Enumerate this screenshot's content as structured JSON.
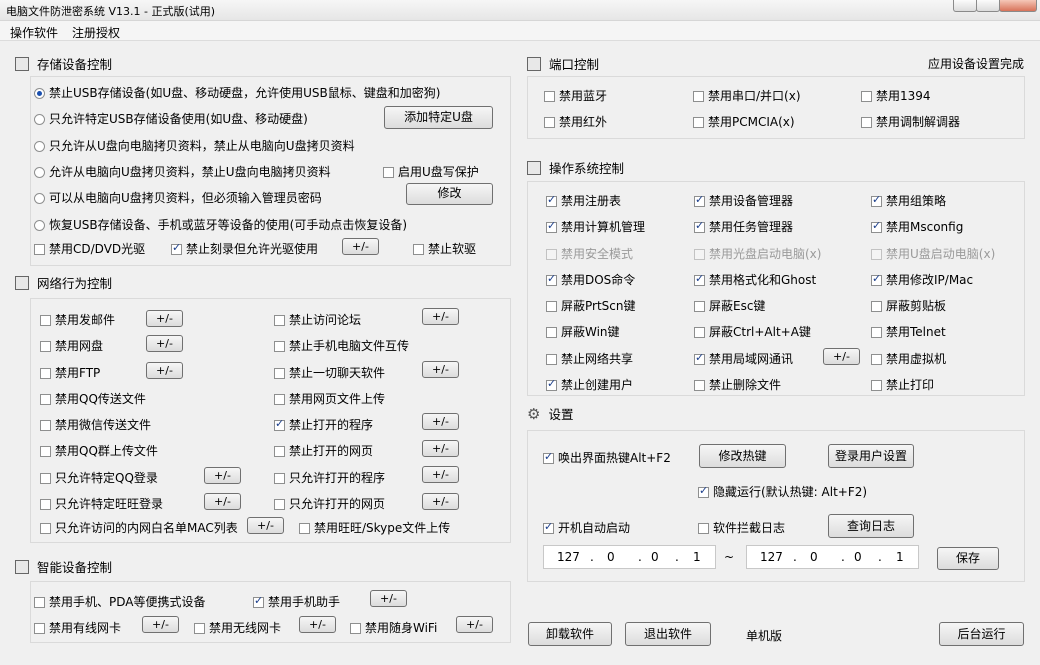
{
  "window": {
    "title": "电脑文件防泄密系统 V13.1 - 正式版(试用)"
  },
  "menu": [
    "操作软件",
    "注册授权"
  ],
  "storage": {
    "title": "存储设备控制",
    "radios": [
      {
        "label": "禁止USB存储设备(如U盘、移动硬盘，允许使用USB鼠标、键盘和加密狗)",
        "checked": true
      },
      {
        "label": "只允许特定USB存储设备使用(如U盘、移动硬盘)",
        "checked": false
      },
      {
        "label": "只允许从U盘向电脑拷贝资料，禁止从电脑向U盘拷贝资料",
        "checked": false
      },
      {
        "label": "允许从电脑向U盘拷贝资料，禁止U盘向电脑拷贝资料",
        "checked": false
      },
      {
        "label": "可以从电脑向U盘拷贝资料，但必须输入管理员密码",
        "checked": false
      },
      {
        "label": "恢复USB存储设备、手机或蓝牙等设备的使用(可手动点击恢复设备)",
        "checked": false
      }
    ],
    "add_usb_button": "添加特定U盘",
    "write_protect": {
      "label": "启用U盘写保护",
      "checked": false
    },
    "modify_button": "修改",
    "cd_disable": {
      "label": "禁用CD/DVD光驱",
      "checked": false
    },
    "burn_disable": {
      "label": "禁止刻录但允许光驱使用",
      "checked": true
    },
    "pm_button": "+/-",
    "floppy_disable": {
      "label": "禁止软驱",
      "checked": false
    }
  },
  "network": {
    "title": "网络行为控制",
    "items": [
      {
        "label": "禁用发邮件",
        "checked": false,
        "pm": true
      },
      {
        "label": "禁止访问论坛",
        "checked": false,
        "pm": true
      },
      {
        "label": "禁用网盘",
        "checked": false,
        "pm": true
      },
      {
        "label": "禁止手机电脑文件互传",
        "checked": false,
        "pm": false
      },
      {
        "label": "禁用FTP",
        "checked": false,
        "pm": true
      },
      {
        "label": "禁止一切聊天软件",
        "checked": false,
        "pm": true
      },
      {
        "label": "禁用QQ传送文件",
        "checked": false,
        "pm": false
      },
      {
        "label": "禁用网页文件上传",
        "checked": false,
        "pm": false
      },
      {
        "label": "禁用微信传送文件",
        "checked": false,
        "pm": false
      },
      {
        "label": "禁止打开的程序",
        "checked": true,
        "pm": true
      },
      {
        "label": "禁用QQ群上传文件",
        "checked": false,
        "pm": false
      },
      {
        "label": "禁止打开的网页",
        "checked": false,
        "pm": true
      },
      {
        "label": "只允许特定QQ登录",
        "checked": false,
        "pm": true
      },
      {
        "label": "只允许打开的程序",
        "checked": false,
        "pm": true
      },
      {
        "label": "只允许特定旺旺登录",
        "checked": false,
        "pm": true
      },
      {
        "label": "只允许打开的网页",
        "checked": false,
        "pm": true
      }
    ],
    "mac_item": {
      "label": "只允许访问的内网白名单MAC列表",
      "checked": false
    },
    "wangwang_item": {
      "label": "禁用旺旺/Skype文件上传",
      "checked": false
    }
  },
  "smart": {
    "title": "智能设备控制",
    "items": [
      {
        "label": "禁用手机、PDA等便携式设备",
        "checked": false
      },
      {
        "label": "禁用手机助手",
        "checked": true
      },
      {
        "label": "禁用有线网卡",
        "checked": false
      },
      {
        "label": "禁用无线网卡",
        "checked": false
      },
      {
        "label": "禁用随身WiFi",
        "checked": false
      }
    ]
  },
  "port": {
    "title": "端口控制",
    "status": "应用设备设置完成",
    "items": [
      {
        "label": "禁用蓝牙",
        "checked": false
      },
      {
        "label": "禁用串口/并口(x)",
        "checked": false
      },
      {
        "label": "禁用1394",
        "checked": false
      },
      {
        "label": "禁用红外",
        "checked": false
      },
      {
        "label": "禁用PCMCIA(x)",
        "checked": false
      },
      {
        "label": "禁用调制解调器",
        "checked": false
      }
    ]
  },
  "os": {
    "title": "操作系统控制",
    "items": [
      {
        "label": "禁用注册表",
        "checked": true,
        "disabled": false
      },
      {
        "label": "禁用设备管理器",
        "checked": true,
        "disabled": false
      },
      {
        "label": "禁用组策略",
        "checked": true,
        "disabled": false
      },
      {
        "label": "禁用计算机管理",
        "checked": true,
        "disabled": false
      },
      {
        "label": "禁用任务管理器",
        "checked": true,
        "disabled": false
      },
      {
        "label": "禁用Msconfig",
        "checked": true,
        "disabled": false
      },
      {
        "label": "禁用安全模式",
        "checked": false,
        "disabled": true
      },
      {
        "label": "禁用光盘启动电脑(x)",
        "checked": false,
        "disabled": true
      },
      {
        "label": "禁用U盘启动电脑(x)",
        "checked": false,
        "disabled": true
      },
      {
        "label": "禁用DOS命令",
        "checked": true,
        "disabled": false
      },
      {
        "label": "禁用格式化和Ghost",
        "checked": true,
        "disabled": false
      },
      {
        "label": "禁用修改IP/Mac",
        "checked": true,
        "disabled": false
      },
      {
        "label": "屏蔽PrtScn键",
        "checked": false,
        "disabled": false
      },
      {
        "label": "屏蔽Esc键",
        "checked": false,
        "disabled": false
      },
      {
        "label": "屏蔽剪贴板",
        "checked": false,
        "disabled": false
      },
      {
        "label": "屏蔽Win键",
        "checked": false,
        "disabled": false
      },
      {
        "label": "屏蔽Ctrl+Alt+A键",
        "checked": false,
        "disabled": false
      },
      {
        "label": "禁用Telnet",
        "checked": false,
        "disabled": false
      },
      {
        "label": "禁止网络共享",
        "checked": false,
        "disabled": false
      },
      {
        "label": "禁用局域网通讯",
        "checked": true,
        "disabled": false
      },
      {
        "label": "禁用虚拟机",
        "checked": false,
        "disabled": false
      },
      {
        "label": "禁止创建用户",
        "checked": true,
        "disabled": false
      },
      {
        "label": "禁止删除文件",
        "checked": false,
        "disabled": false
      },
      {
        "label": "禁止打印",
        "checked": false,
        "disabled": false
      }
    ],
    "pm_button": "+/-"
  },
  "settings": {
    "title": "设置",
    "hotkey": {
      "label": "唤出界面热键Alt+F2",
      "checked": true
    },
    "modify_hotkey_button": "修改热键",
    "login_user_button": "登录用户设置",
    "hidden_run": {
      "label": "隐藏运行(默认热键: Alt+F2)",
      "checked": true
    },
    "autostart": {
      "label": "开机自动启动",
      "checked": true
    },
    "intercept_log": {
      "label": "软件拦截日志",
      "checked": false
    },
    "query_log_button": "查询日志",
    "ip1": [
      "127",
      "0",
      "0",
      "1"
    ],
    "ip2": [
      "127",
      "0",
      "0",
      "1"
    ],
    "ip_sep": "~",
    "save_button": "保存"
  },
  "bottom": {
    "uninstall_button": "卸载软件",
    "exit_button": "退出软件",
    "mode_text": "单机版",
    "background_button": "后台运行"
  }
}
